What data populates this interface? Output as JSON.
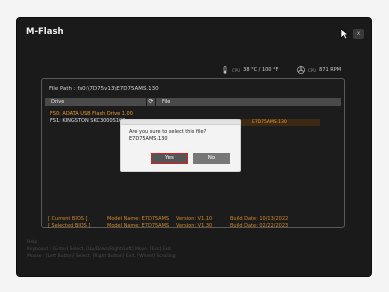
{
  "window": {
    "title": "M-Flash",
    "close_label": "x"
  },
  "status": {
    "cpu_label": "CPU",
    "cpu_value": "38 °C / 100 °F",
    "cpu_fan_label": "CPU",
    "cpu_fan_value": "871 RPM"
  },
  "file_path": "File Path : fs0:\\7D75v13\\E7D75AMS.130",
  "drive_header": "Drive",
  "file_header": "File",
  "drives": [
    {
      "label": "FS0: ADATA USB Flash Drive 1.00"
    },
    {
      "label": "FS1: KINGSTON SKC3000S102"
    }
  ],
  "file_row": {
    "date": "...2022",
    "name": "E7D75AMS.130"
  },
  "bios": {
    "current": {
      "label": "[ Current BIOS ]",
      "model": "Model Name: E7D75AMS",
      "version": "Version: V1.10",
      "date": "Build Date: 10/13/2022"
    },
    "selected": {
      "label": "[ Selected BIOS ]",
      "model": "Model Name: E7D75AMS",
      "version": "Version: V1.30",
      "date": "Build Date: 02/22/2023"
    }
  },
  "help": {
    "title": "Help",
    "keyboard": "Keyboard : [Enter] Select,  [Up/Down/Right/Left]  Move,  [Esc]  Exit",
    "mouse": "Mouse     : [Left Button] Select,  [Right Button]  Exit,  [Wheel]  Scrolling"
  },
  "dialog": {
    "message_line1": "Are you sure to select this file?",
    "message_line2": "E7D75AMS.130",
    "yes_label": "Yes",
    "no_label": "No"
  },
  "colors": {
    "accent": "#f09a2e",
    "highlight_border": "#d81f26"
  }
}
